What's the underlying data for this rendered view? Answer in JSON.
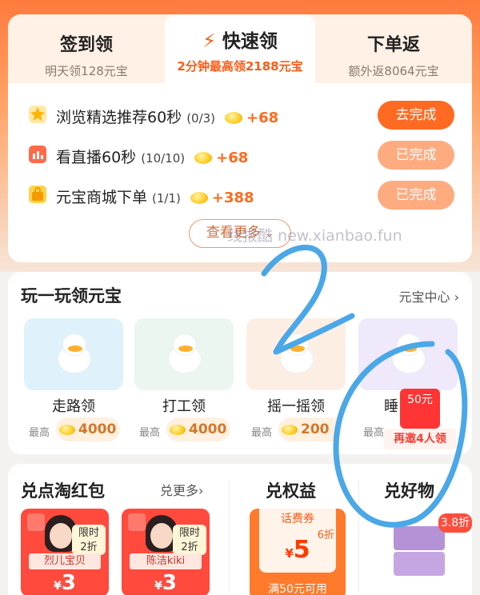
{
  "tabs": [
    {
      "title": "签到领",
      "subtitle": "明天领128元宝"
    },
    {
      "title": "快速领",
      "subtitle": "2分钟最高领2188元宝"
    },
    {
      "title": "下单返",
      "subtitle": "额外返8064元宝"
    }
  ],
  "tasks": [
    {
      "name": "浏览精选推荐60秒",
      "count": "(0/3)",
      "reward": "+68",
      "button": "去完成",
      "icon_label": "60s"
    },
    {
      "name": "看直播60秒",
      "count": "(10/10)",
      "reward": "+68",
      "button": "已完成",
      "icon_label": "60s"
    },
    {
      "name": "元宝商城下单",
      "count": "(1/1)",
      "reward": "+388",
      "button": "已完成"
    }
  ],
  "more_label": "查看更多",
  "watermark": "线报酷 new.xianbao.fun",
  "play": {
    "title": "玩一玩领元宝",
    "link": "元宝中心",
    "max_label": "最高",
    "games": [
      {
        "name": "走路领",
        "value": "4000"
      },
      {
        "name": "打工领",
        "value": "4000"
      },
      {
        "name": "摇一摇领",
        "value": "200"
      },
      {
        "name": "睡",
        "value": ""
      }
    ],
    "invite": {
      "amount": "50元",
      "label": "再邀4人领"
    }
  },
  "bottom": {
    "redpack": {
      "title": "兑点淘红包",
      "link": "兑更多",
      "items": [
        {
          "name": "烈儿宝贝",
          "badge_line1": "限时",
          "badge_line2": "2折",
          "currency": "¥",
          "value": "3"
        },
        {
          "name": "陈洁kiki",
          "badge_line1": "限时",
          "badge_line2": "2折",
          "currency": "¥",
          "value": "3"
        }
      ]
    },
    "rights": {
      "title": "兑权益",
      "voucher_title": "话费券",
      "discount": "6折",
      "currency": "¥",
      "value": "5",
      "note": "满50元可用"
    },
    "goods": {
      "title": "兑好物",
      "discount": "3.8折"
    }
  },
  "colors": {
    "accent": "#ff5a14",
    "button_active": "#ff6a22",
    "button_done": "#ffab80",
    "pen": "#4aa7e8"
  }
}
